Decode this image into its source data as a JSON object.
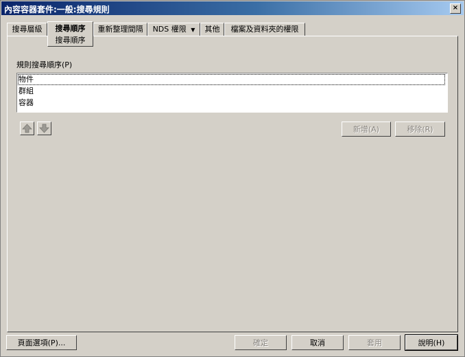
{
  "window": {
    "title": "內容容器套件:一般:搜尋規則",
    "close_glyph": "×"
  },
  "tabs": [
    {
      "label": "搜尋層級"
    },
    {
      "label": "搜尋順序"
    },
    {
      "label": "重新整理間隔"
    },
    {
      "label": "NDS 權限"
    },
    {
      "label": "其他"
    },
    {
      "label": "檔案及資料夾的權限"
    }
  ],
  "nds_dropdown_glyph": "▼",
  "subtab": {
    "label": "搜尋順序"
  },
  "rules": {
    "label": "規則搜尋順序(P)",
    "items": [
      "物件",
      "群組",
      "容器"
    ]
  },
  "buttons": {
    "add": "新增(A)",
    "remove": "移除(R)",
    "page_options": "頁面選項(P)...",
    "ok": "確定",
    "cancel": "取消",
    "apply": "套用",
    "help": "說明(H)"
  },
  "icons": {
    "move_up": "arrow-up-icon",
    "move_down": "arrow-down-icon",
    "close": "close-icon"
  },
  "colors": {
    "title_start": "#0a246a",
    "title_end": "#a6caf0",
    "face": "#d4d0c8"
  }
}
